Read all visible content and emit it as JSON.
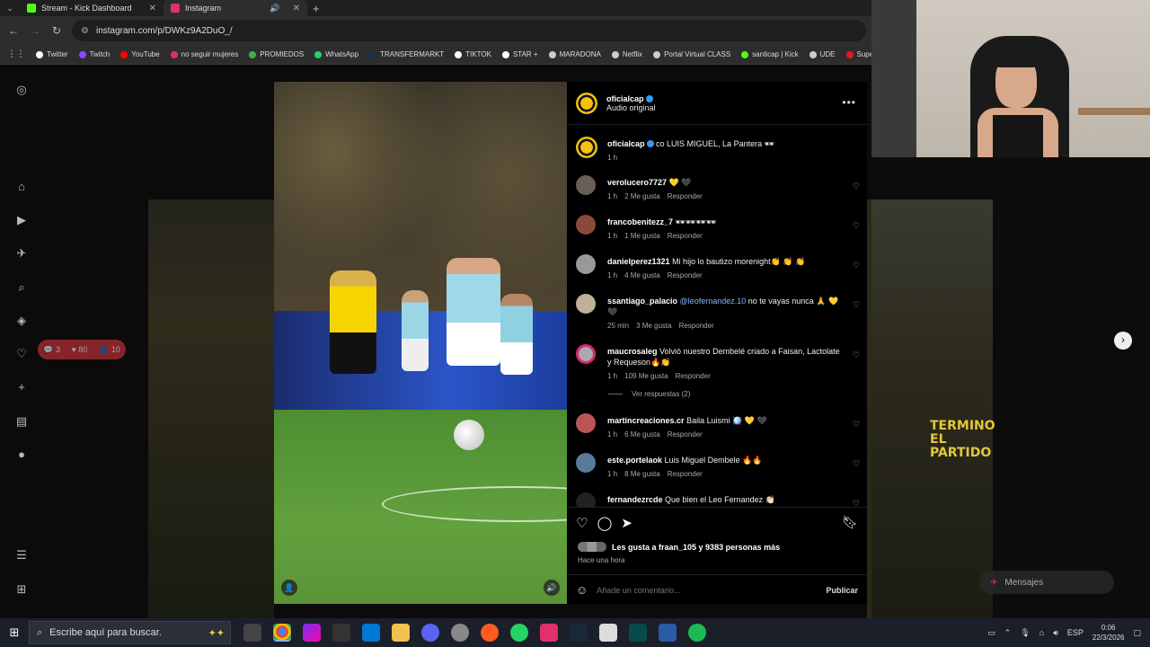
{
  "browser": {
    "tabs": [
      {
        "label": "Stream - Kick Dashboard",
        "color": "#53fc18",
        "active": false
      },
      {
        "label": "Instagram",
        "color": "#e1306c",
        "active": true
      }
    ],
    "url": "instagram.com/p/DWKz9A2DuO_/",
    "bookmarks": [
      {
        "label": "Twitter",
        "color": "#ffffff"
      },
      {
        "label": "Twitch",
        "color": "#9146ff"
      },
      {
        "label": "YouTube",
        "color": "#ff0000"
      },
      {
        "label": "no seguir mujeres",
        "color": "#e1306c"
      },
      {
        "label": "PROMIEDOS",
        "color": "#3bb54a"
      },
      {
        "label": "WhatsApp",
        "color": "#25d366"
      },
      {
        "label": "TRANSFERMARKT",
        "color": "#1a3151"
      },
      {
        "label": "TIKTOK",
        "color": "#ffffff"
      },
      {
        "label": "STAR +",
        "color": "#ffffff"
      },
      {
        "label": "MARADONA",
        "color": "#cccccc"
      },
      {
        "label": "Netflix",
        "color": "#cccccc"
      },
      {
        "label": "Portal Virtual CLASS",
        "color": "#cccccc"
      },
      {
        "label": "santicap | Kick",
        "color": "#53fc18"
      },
      {
        "label": "UDE",
        "color": "#cccccc"
      },
      {
        "label": "Supe",
        "color": "#e21b22"
      }
    ]
  },
  "sidebar": {
    "notif_pill": {
      "comments": "3",
      "likes": "80",
      "follows": "10"
    }
  },
  "post": {
    "username": "oficialcap",
    "subtitle": "Audio original",
    "caption_user": "oficialcap",
    "caption_text": "co LUIS MIGUEL, La Pantera 🕶",
    "caption_time": "1 h",
    "comments": [
      {
        "user": "verolucero7727",
        "text": "💛 🖤",
        "time": "1 h",
        "likes": "2 Me gusta",
        "reply": "Responder"
      },
      {
        "user": "francobenitezz_7",
        "text": "🕶🕶🕶🕶",
        "time": "1 h",
        "likes": "1 Me gusta",
        "reply": "Responder"
      },
      {
        "user": "danielperez1321",
        "text": "Mi hijo lo bautizo morenight👏 👏 👏",
        "time": "1 h",
        "likes": "4 Me gusta",
        "reply": "Responder"
      },
      {
        "user": "ssantiago_palacio",
        "mention": "@leofernandez.10",
        "text": "no te vayas nunca 🙏 💛 🖤",
        "time": "25 min",
        "likes": "3 Me gusta",
        "reply": "Responder"
      },
      {
        "user": "maucrosaleg",
        "text": "Volvió nuestro Dembelé criado a Faisan, Lactolate y Requeson🔥👏",
        "time": "1 h",
        "likes": "109 Me gusta",
        "reply": "Responder"
      },
      {
        "user": "martincreaciones.cr",
        "text": "Baila Luismi 🪩 💛 🖤",
        "time": "1 h",
        "likes": "6 Me gusta",
        "reply": "Responder"
      },
      {
        "user": "este.portelaok",
        "text": "Luis Miguel Dembele 🔥🔥",
        "time": "1 h",
        "likes": "8 Me gusta",
        "reply": "Responder"
      },
      {
        "user": "fernandezrcde",
        "text": "Que bien el Leo Fernandez 👏🏻",
        "time": "",
        "likes": "",
        "reply": ""
      }
    ],
    "view_replies": "Ver respuestas (2)",
    "likes_text": "Les gusta a fraan_105 y 9383 personas más",
    "posted": "Hace una hora",
    "comment_placeholder": "Añade un comentario...",
    "publish": "Publicar"
  },
  "right": {
    "overlay_text_1": "TERMINO",
    "overlay_text_2": "EL PARTIDO",
    "messages": "Mensajes"
  },
  "taskbar": {
    "search_placeholder": "Escribe aquí para buscar.",
    "lang": "ESP",
    "time": "0:06",
    "date": "22/3/2026"
  }
}
